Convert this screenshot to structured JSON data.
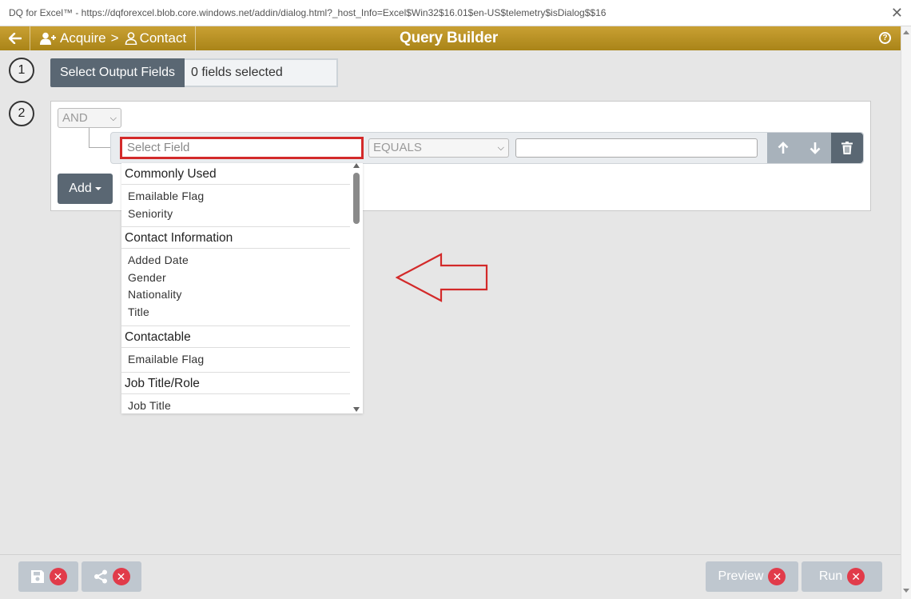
{
  "window": {
    "title": "DQ for Excel™ - https://dqforexcel.blob.core.windows.net/addin/dialog.html?_host_Info=Excel$Win32$16.01$en-US$telemetry$isDialog$$16",
    "close_glyph": "✕"
  },
  "header": {
    "back_icon": "arrow-left-icon",
    "crumb_acquire": "Acquire",
    "crumb_separator": ">",
    "crumb_contact": "Contact",
    "title": "Query Builder",
    "help_glyph": "?"
  },
  "steps": {
    "one": "1",
    "two": "2"
  },
  "output": {
    "button_label": "Select Output Fields",
    "selected_text": "0 fields selected"
  },
  "query": {
    "logic_value": "AND",
    "field_placeholder": "Select Field",
    "operator_value": "EQUALS",
    "value": "",
    "add_label": "Add"
  },
  "dropdown": {
    "groups": [
      {
        "label": "Commonly Used",
        "items": [
          "Emailable Flag",
          "Seniority"
        ]
      },
      {
        "label": "Contact Information",
        "items": [
          "Added Date",
          "Gender",
          "Nationality",
          "Title"
        ]
      },
      {
        "label": "Contactable",
        "items": [
          "Emailable Flag"
        ]
      },
      {
        "label": "Job Title/Role",
        "items": [
          "Job Title"
        ]
      }
    ]
  },
  "footer": {
    "preview_label": "Preview",
    "run_label": "Run",
    "x_glyph": "✕"
  },
  "colors": {
    "header_gold": "#b8921f",
    "button_dark": "#5a6773",
    "highlight_red": "#d32a2a",
    "x_red": "#e13b4a"
  }
}
